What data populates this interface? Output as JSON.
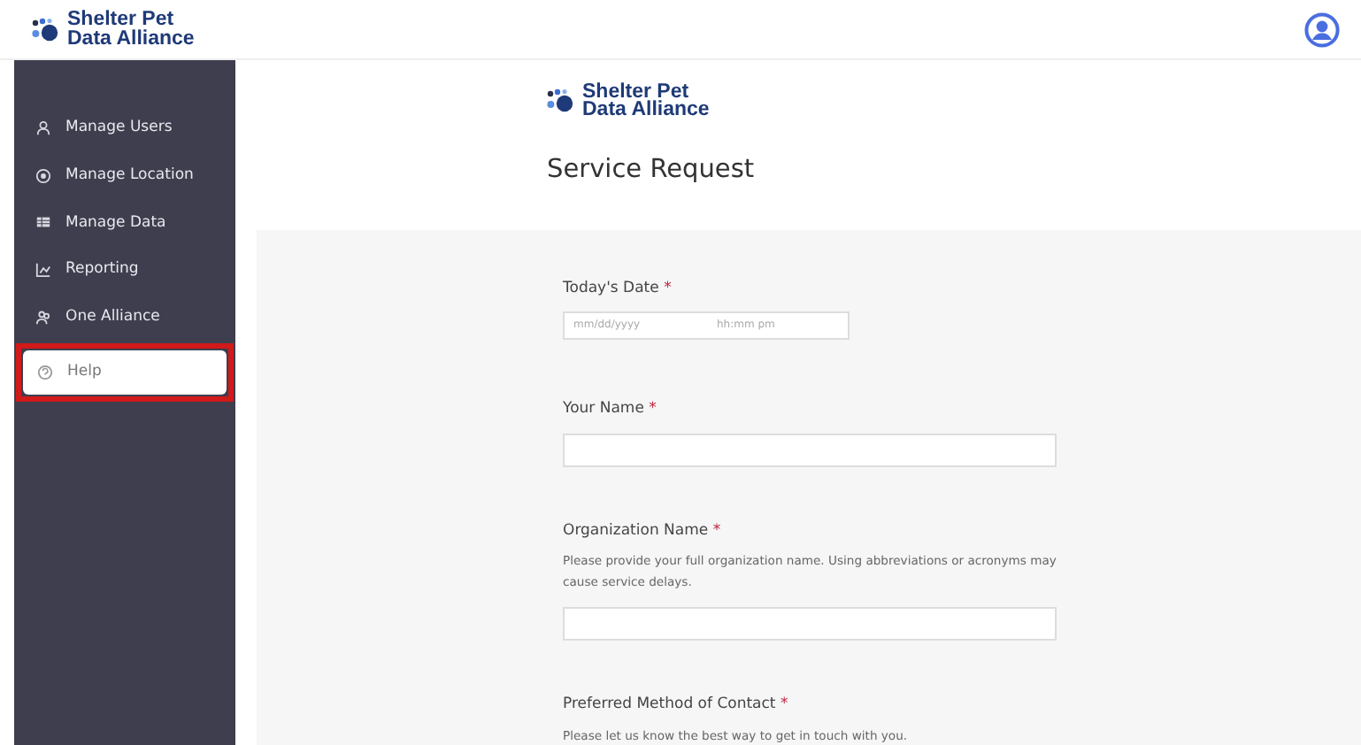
{
  "header": {
    "logo": {
      "line_1": "Shelter Pet",
      "line_2": "Data Alliance"
    }
  },
  "sidebar": {
    "items": [
      {
        "label": "Manage Users",
        "selected": false,
        "highlighted": false
      },
      {
        "label": "Manage Location",
        "selected": false,
        "highlighted": false
      },
      {
        "label": "Manage Data",
        "selected": false,
        "highlighted": false
      },
      {
        "label": "Reporting",
        "selected": false,
        "highlighted": false
      },
      {
        "label": "One Alliance",
        "selected": false,
        "highlighted": false
      },
      {
        "label": "Help",
        "selected": true,
        "highlighted": true
      }
    ]
  },
  "form": {
    "logo": {
      "line_1": "Shelter Pet",
      "line_2": "Data Alliance"
    },
    "title": "Service Request",
    "fields": [
      {
        "kind": "datetime",
        "label": "Today's Date",
        "required_mark": "*",
        "placeholders": [
          "mm/dd/yyyy",
          "hh:mm pm"
        ]
      },
      {
        "kind": "text",
        "label": "Your Name",
        "required_mark": "*"
      },
      {
        "kind": "text",
        "label": "Organization Name",
        "required_mark": "*",
        "help": "Please provide your full organization name. Using abbreviations or acronyms may cause service delays."
      },
      {
        "kind": "group",
        "label": "Preferred Method of Contact",
        "required_mark": "*",
        "help": "Please let us know the best way to get in touch with you."
      }
    ]
  }
}
